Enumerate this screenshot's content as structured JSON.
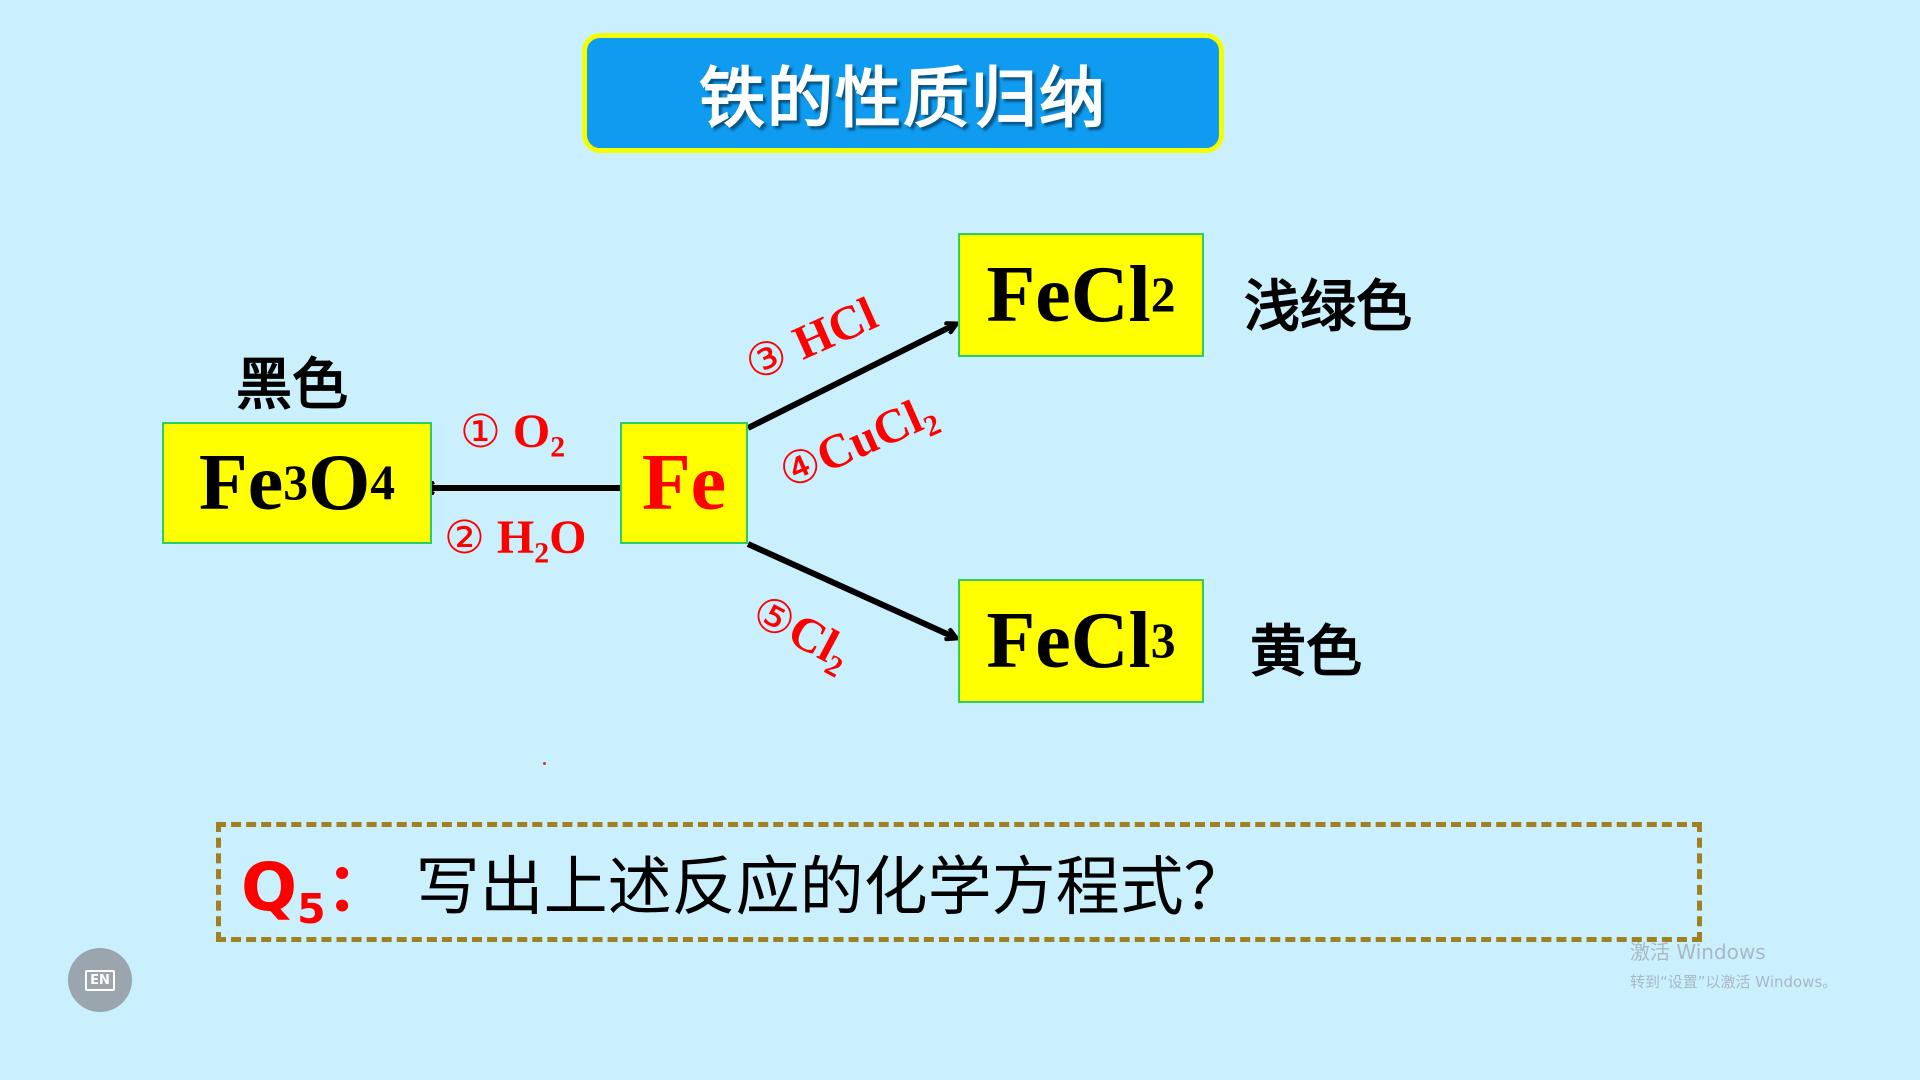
{
  "slide": {
    "title": "铁的性质归纳",
    "compounds": {
      "fe3o4": {
        "main": "Fe",
        "sub1": "3",
        "mid": "O",
        "sub2": "4"
      },
      "fe": {
        "main": "Fe"
      },
      "fecl2": {
        "main": "FeCl",
        "sub": "2"
      },
      "fecl3": {
        "main": "FeCl",
        "sub": "3"
      }
    },
    "color_labels": {
      "black": "黑色",
      "light_green": "浅绿色",
      "yellow": "黄色"
    },
    "conditions": {
      "c1": {
        "num": "①",
        "main": " O",
        "sub": "2"
      },
      "c2": {
        "num": "②",
        "main": " H",
        "sub": "2",
        "tail": "O"
      },
      "c3": {
        "num": "③",
        "main": " HCl"
      },
      "c4": {
        "num": "④",
        "main": "CuCl",
        "sub": "2"
      },
      "c5": {
        "num": "⑤",
        "main": "Cl",
        "sub": "2"
      }
    },
    "question": {
      "label": "Q",
      "label_sub": "5",
      "label_colon": "：",
      "text": "写出上述反应的化学方程式？"
    }
  },
  "watermark": {
    "line1": "激活 Windows",
    "line2": "转到“设置”以激活 Windows。"
  },
  "corner_button": {
    "label": "EN"
  },
  "colors": {
    "background": "#cbf0fd",
    "title_bg": "#0e9bf0",
    "title_border": "#f3ff00",
    "box_fill": "#ffff00",
    "box_border": "#2ccd64",
    "accent_red": "#ff0000",
    "dashed_border": "#a08020"
  }
}
